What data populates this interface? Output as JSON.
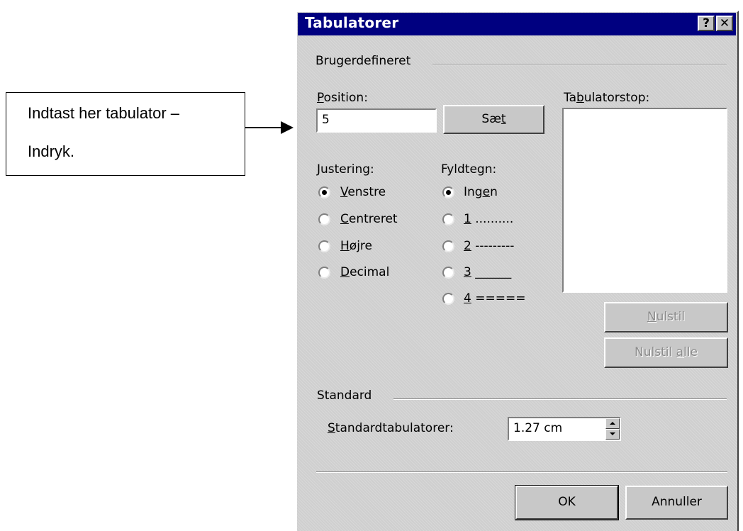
{
  "callout": {
    "line1": "Indtast her tabulator –",
    "line2": "Indryk."
  },
  "dialog": {
    "title": "Tabulatorer",
    "help_button": "?",
    "close_button": "✕",
    "custom_group": "Brugerdefineret",
    "position": {
      "label_underlined": "P",
      "label_rest": "osition:",
      "value": "5"
    },
    "set_button": {
      "pre": "Sæ",
      "underlined": "t",
      "post": ""
    },
    "tab_stops": {
      "label_pre": "Ta",
      "label_underlined": "b",
      "label_post": "ulatorstop:"
    },
    "alignment": {
      "label": "Justering:",
      "options": [
        {
          "underlined": "V",
          "rest": "enstre",
          "checked": true
        },
        {
          "underlined": "C",
          "rest": "entreret",
          "checked": false
        },
        {
          "underlined": "H",
          "rest": "øjre",
          "checked": false
        },
        {
          "underlined": "D",
          "rest": "ecimal",
          "checked": false
        }
      ]
    },
    "leader": {
      "label": "Fyldtegn:",
      "options": [
        {
          "pre": "Ing",
          "underlined": "e",
          "post": "n",
          "checked": true
        },
        {
          "pre": "",
          "underlined": "1",
          "post": " ..........",
          "checked": false
        },
        {
          "pre": "",
          "underlined": "2",
          "post": " ---------",
          "checked": false
        },
        {
          "pre": "",
          "underlined": "3",
          "post": " ______",
          "checked": false
        },
        {
          "pre": "",
          "underlined": "4",
          "post": " =====",
          "checked": false
        }
      ]
    },
    "clear_button": {
      "underlined": "N",
      "rest": "ulstil"
    },
    "clear_all_button": {
      "pre": "Nulstil ",
      "underlined": "a",
      "post": "lle"
    },
    "standard_group": "Standard",
    "default_tabs": {
      "label_underlined": "S",
      "label_rest": "tandardtabulatorer:",
      "value": "1.27 cm"
    },
    "ok_button": "OK",
    "cancel_button": "Annuller"
  }
}
